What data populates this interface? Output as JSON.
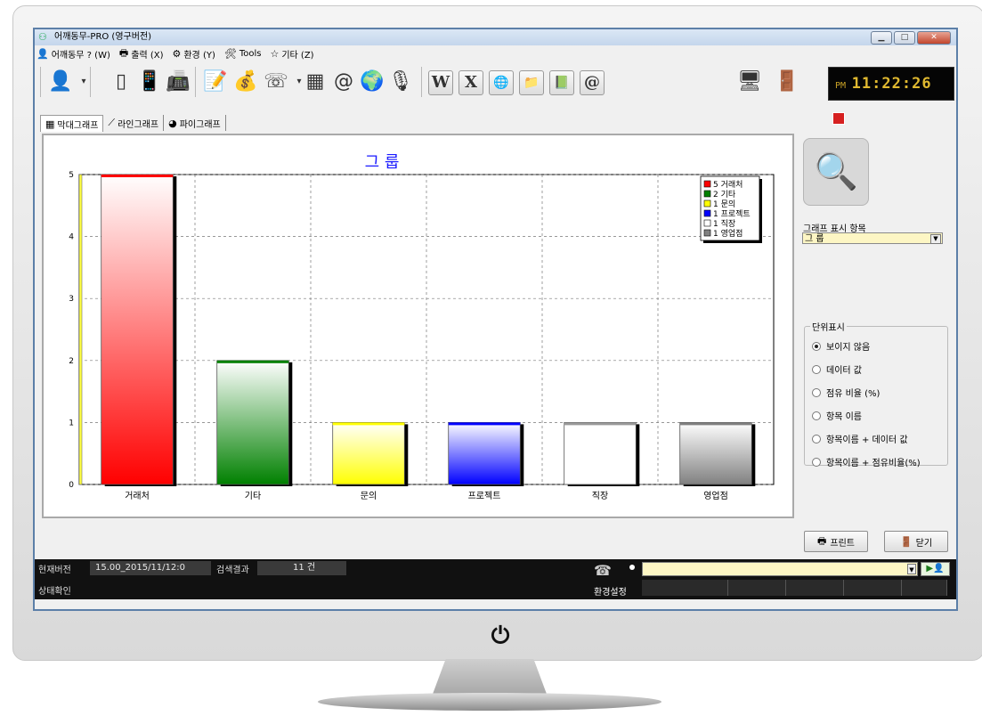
{
  "window": {
    "title": "어깨동무-PRO (영구버전)",
    "controls": {
      "minimize": "▁",
      "maximize": "□",
      "close": "✕"
    }
  },
  "menu": [
    {
      "icon": "person-icon",
      "glyph": "👤",
      "label": "어깨동무 ? (W)"
    },
    {
      "icon": "printer-icon",
      "glyph": "🖶",
      "label": "출력 (X)"
    },
    {
      "icon": "gear-icon",
      "glyph": "⚙",
      "label": "환경 (Y)"
    },
    {
      "icon": "tools-icon",
      "glyph": "🛠",
      "label": "Tools"
    },
    {
      "icon": "star-icon",
      "glyph": "☆",
      "label": "기타 (Z)"
    }
  ],
  "toolbar": {
    "word_label": "W",
    "excel_label": "X",
    "at_label": "@",
    "clock": {
      "ampm": "PM",
      "time": "11:22:26"
    }
  },
  "tabs": [
    {
      "label": "막대그래프",
      "icon": "bar-chart-icon",
      "glyph": "▦"
    },
    {
      "label": "라인그래프",
      "icon": "line-chart-icon",
      "glyph": "⟋"
    },
    {
      "label": "파이그래프",
      "icon": "pie-chart-icon",
      "glyph": "◕"
    }
  ],
  "side": {
    "graph_item_label": "그래프 표시 항목",
    "graph_item_value": "그 룹",
    "unit_title": "단위표시",
    "unit_options": [
      "보이지 않음",
      "데이터 값",
      "점유 비율 (%)",
      "항목 이름",
      "항목이름 + 데이터 값",
      "항목이름 + 점유비율(%)"
    ],
    "unit_selected_index": 0,
    "print_label": "프린트",
    "close_label": "닫기"
  },
  "status": {
    "version_label": "현재버전",
    "version_value": "15.00_2015/11/12:0",
    "result_label": "검색결과",
    "result_value": "11 건",
    "state_label": "상태확인",
    "settings_label": "환경설정",
    "go_label": "▶",
    "input_value": ""
  },
  "chart_data": {
    "type": "bar",
    "title": "그 룹",
    "categories": [
      "거래처",
      "기타",
      "문의",
      "프로젝트",
      "직장",
      "영업점"
    ],
    "values": [
      5,
      2,
      1,
      1,
      1,
      1
    ],
    "colors": [
      "#ff0000",
      "#008000",
      "#ffff00",
      "#0000ff",
      "#ffffff",
      "#808080"
    ],
    "ylim": [
      0,
      5
    ],
    "yticks": [
      0,
      1,
      2,
      3,
      4,
      5
    ],
    "grid": true,
    "legend": {
      "position": "top-right",
      "entries": [
        "5 거래처",
        "2 기타",
        "1 문의",
        "1 프로젝트",
        "1 직장",
        "1 영업점"
      ]
    }
  }
}
